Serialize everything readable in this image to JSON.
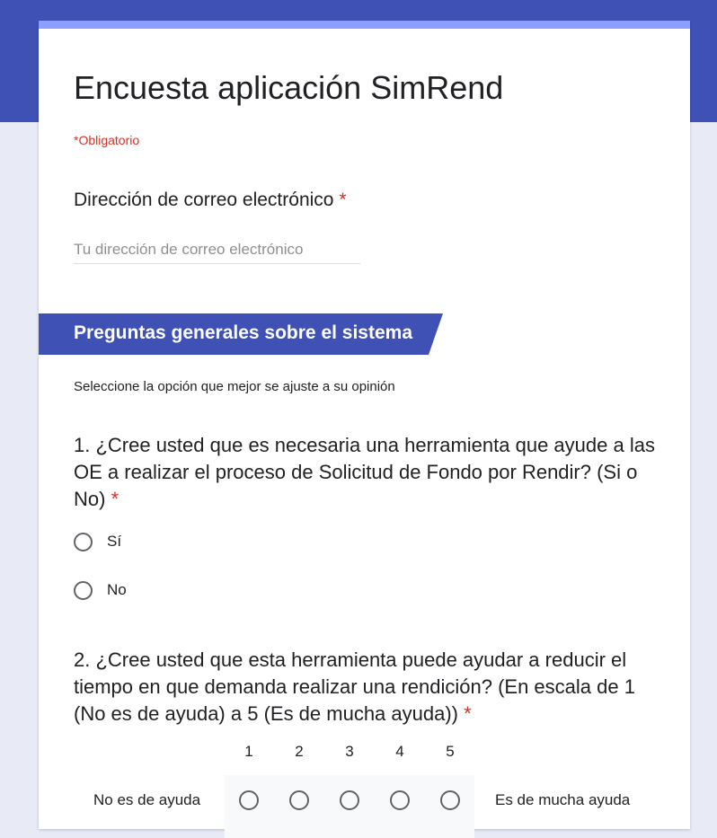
{
  "form": {
    "title": "Encuesta aplicación SimRend",
    "required_note": "*Obligatorio",
    "accent_color": "#3f51b5"
  },
  "email": {
    "label": "Dirección de correo electrónico",
    "asterisk": "*",
    "placeholder": "Tu dirección de correo electrónico",
    "value": ""
  },
  "section": {
    "title": "Preguntas generales sobre el sistema",
    "description": "Seleccione la opción que mejor se ajuste a su opinión"
  },
  "q1": {
    "text": "1.  ¿Cree usted que es necesaria una herramienta que ayude a las OE a realizar el proceso de Solicitud de Fondo por Rendir? (Si o No)",
    "asterisk": "*",
    "options": [
      "Sí",
      "No"
    ]
  },
  "q2": {
    "text": "2.  ¿Cree usted que esta herramienta puede ayudar a reducir el tiempo en que demanda realizar una rendición? (En escala de 1 (No es de ayuda) a 5 (Es de mucha ayuda))",
    "asterisk": "*",
    "scale": [
      "1",
      "2",
      "3",
      "4",
      "5"
    ],
    "low_label": "No es de ayuda",
    "high_label": "Es de mucha ayuda"
  }
}
